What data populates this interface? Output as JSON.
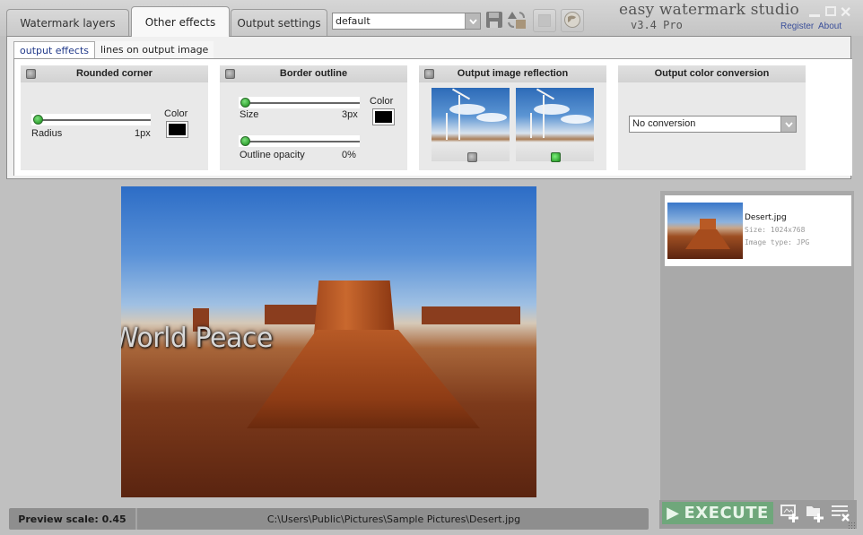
{
  "app": {
    "title": "easy watermark studio",
    "version": "v3.4 Pro",
    "links": {
      "register": "Register",
      "about": "About"
    }
  },
  "main_tabs": [
    {
      "label": "Watermark layers",
      "active": false
    },
    {
      "label": "Other effects",
      "active": true
    },
    {
      "label": "Output settings",
      "active": false
    }
  ],
  "toolbar": {
    "preset_value": "default",
    "buttons": [
      {
        "icon": "save-icon",
        "enabled": true
      },
      {
        "icon": "import-export-icon",
        "enabled": true
      },
      {
        "icon": "blank-icon",
        "enabled": false
      },
      {
        "icon": "globe-icon",
        "enabled": true
      }
    ]
  },
  "sub_tabs": [
    {
      "label": "output effects",
      "active": true
    },
    {
      "label": "lines on output image",
      "active": false
    }
  ],
  "effects": {
    "rounded_corner": {
      "title": "Rounded corner",
      "enabled": false,
      "radius_label": "Radius",
      "radius_value": "1px",
      "radius_fraction": 0.0,
      "color_label": "Color",
      "color": "#000000"
    },
    "border_outline": {
      "title": "Border outline",
      "enabled": false,
      "size_label": "Size",
      "size_value": "3px",
      "size_fraction": 0.0,
      "opacity_label": "Outline opacity",
      "opacity_value": "0%",
      "opacity_fraction": 0.0,
      "color_label": "Color",
      "color": "#000000"
    },
    "reflection": {
      "title": "Output image reflection",
      "enabled": false,
      "options": [
        {
          "name": "flat-reflection",
          "selected": false
        },
        {
          "name": "perspective-reflection",
          "selected": true
        }
      ]
    },
    "color_conversion": {
      "title": "Output color conversion",
      "selected": "No conversion"
    }
  },
  "preview": {
    "watermark_text": "World Peace"
  },
  "file_list": [
    {
      "name": "Desert.jpg",
      "size": "Size: 1024x768",
      "type": "Image type: JPG"
    }
  ],
  "status": {
    "preview_scale": "Preview scale: 0.45",
    "path": "C:\\Users\\Public\\Pictures\\Sample Pictures\\Desert.jpg"
  },
  "actions": {
    "execute_label": "EXECUTE",
    "icons": [
      "add-image-icon",
      "add-folder-icon",
      "clear-list-icon"
    ]
  },
  "colors": {
    "accent_green": "#6fa77b",
    "link_blue": "#3a4f9a",
    "active_subtab": "#223a8a"
  }
}
